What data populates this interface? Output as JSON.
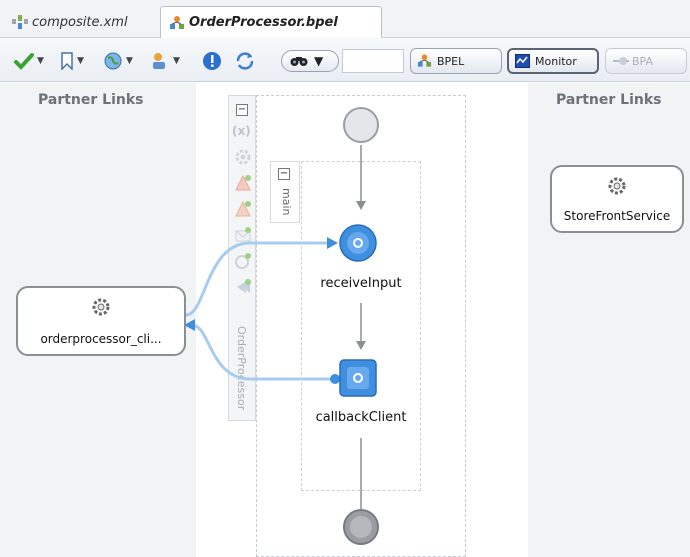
{
  "tabs": [
    {
      "label": "composite.xml",
      "active": false
    },
    {
      "label": "OrderProcessor.bpel",
      "active": true
    }
  ],
  "toolbar": {
    "mode_buttons": {
      "bpel": "BPEL",
      "monitor": "Monitor",
      "bpa": "BPA"
    }
  },
  "canvas": {
    "left_title": "Partner Links",
    "right_title": "Partner Links",
    "left_partner": "orderprocessor_cli...",
    "right_partner": "StoreFrontService",
    "scope_name": "main",
    "process_name": "OrderProcessor",
    "activities": {
      "receive": "receiveInput",
      "invoke": "callbackClient"
    }
  },
  "colors": {
    "activity_blue": "#3f8fe0",
    "link_blue": "#9cc3ee",
    "partner_panel": "#f1f3f5"
  }
}
